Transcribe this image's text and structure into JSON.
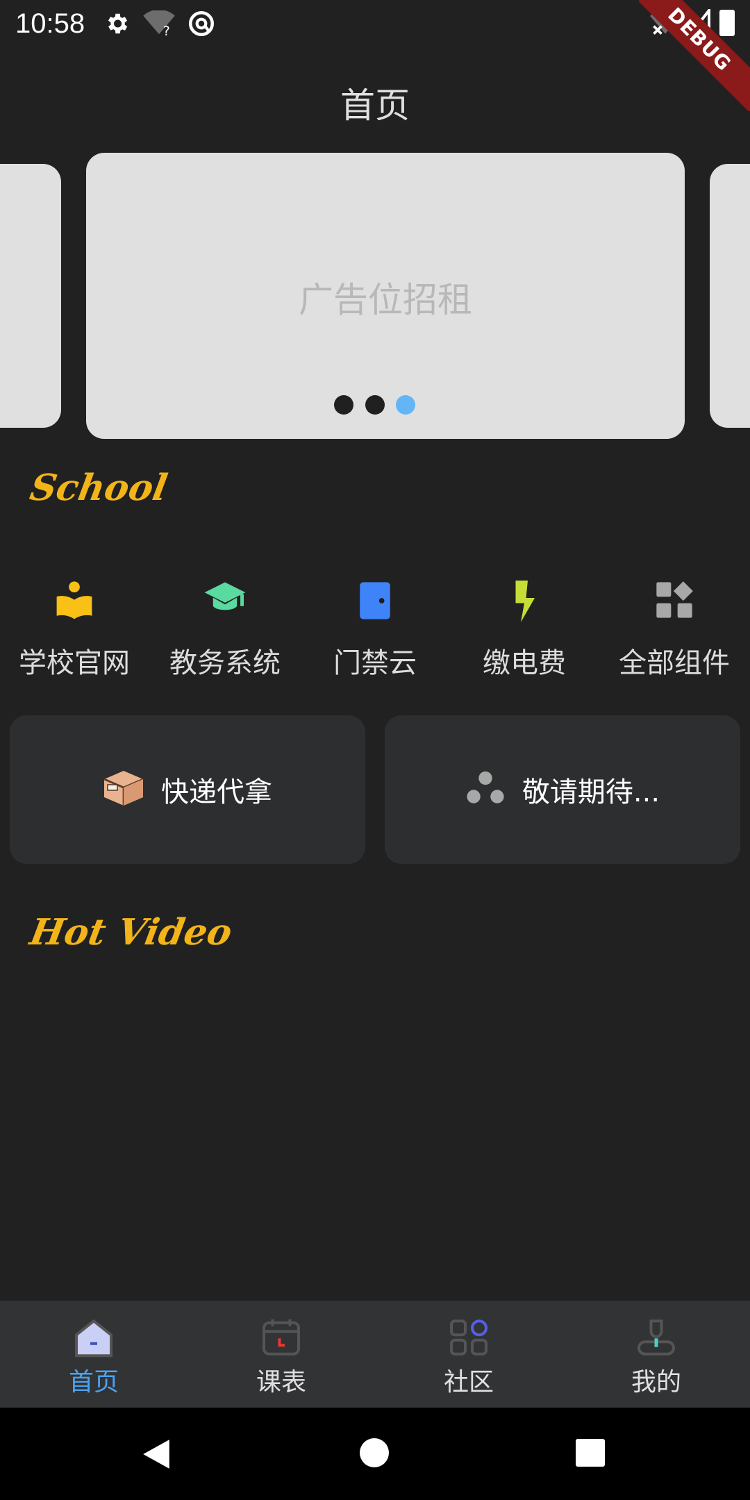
{
  "status_bar": {
    "time": "10:58",
    "icons": [
      "gear-icon",
      "wifi-unknown-icon",
      "at-sign-icon",
      "wifi-off-icon",
      "signal-icon",
      "battery-icon"
    ],
    "debug_label": "DEBUG"
  },
  "header": {
    "title": "首页"
  },
  "carousel": {
    "banner_text": "广告位招租",
    "page_count": 3,
    "active_index": 2,
    "active_dot_color": "#64b5f6",
    "inactive_dot_color": "#202020"
  },
  "school_section": {
    "title": "School",
    "items": [
      {
        "label": "学校官网",
        "icon": "school-reader-icon",
        "color": "#f9c015"
      },
      {
        "label": "教务系统",
        "icon": "graduation-cap-icon",
        "color": "#5ad9a0"
      },
      {
        "label": "门禁云",
        "icon": "door-icon",
        "color": "#3f83f8"
      },
      {
        "label": "缴电费",
        "icon": "lightning-icon",
        "color": "#c6dd36"
      },
      {
        "label": "全部组件",
        "icon": "all-widgets-icon",
        "color": "#a8a8a8"
      }
    ]
  },
  "feature_cards": [
    {
      "label": "快递代拿",
      "icon": "package-box-icon"
    },
    {
      "label": "敬请期待...",
      "icon": "dots-cluster-icon"
    }
  ],
  "video_section": {
    "title": "Hot Video"
  },
  "bottom_nav": {
    "active_index": 0,
    "items": [
      {
        "label": "首页",
        "icon": "home-icon"
      },
      {
        "label": "课表",
        "icon": "calendar-icon"
      },
      {
        "label": "社区",
        "icon": "community-grid-icon"
      },
      {
        "label": "我的",
        "icon": "profile-icon"
      }
    ]
  },
  "system_nav": {
    "icons": [
      "back-icon",
      "home-circle-icon",
      "recents-square-icon"
    ]
  }
}
